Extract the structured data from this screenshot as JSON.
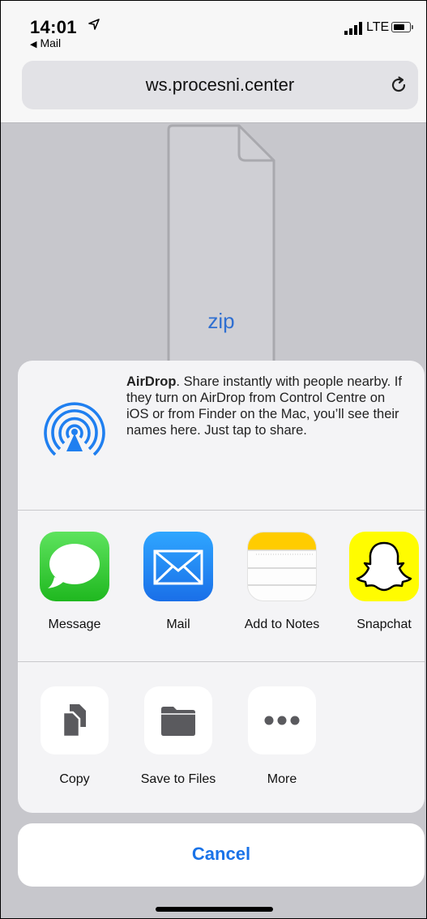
{
  "status_bar": {
    "time": "14:01",
    "back_app": "Mail",
    "network": "LTE"
  },
  "url_bar": {
    "url": "ws.procesni.center"
  },
  "page": {
    "file_type_label": "zip"
  },
  "share_sheet": {
    "airdrop": {
      "title": "AirDrop",
      "description": ". Share instantly with people nearby. If they turn on AirDrop from Control Centre on iOS or from Finder on the Mac, you’ll see their names here. Just tap to share."
    },
    "apps": [
      {
        "label": "Message",
        "icon": "message-icon",
        "color": "#34c759"
      },
      {
        "label": "Mail",
        "icon": "mail-icon",
        "color": "#2a8bf2"
      },
      {
        "label": "Add to Notes",
        "icon": "notes-icon",
        "color": "#ffcc00"
      },
      {
        "label": "Snapchat",
        "icon": "snapchat-icon",
        "color": "#fffc00"
      }
    ],
    "actions": [
      {
        "label": "Copy",
        "icon": "copy-icon"
      },
      {
        "label": "Save to Files",
        "icon": "folder-icon"
      },
      {
        "label": "More",
        "icon": "more-icon"
      }
    ],
    "cancel_label": "Cancel"
  },
  "colors": {
    "accent": "#1a73e8",
    "airdrop_blue": "#1f7ff0"
  }
}
